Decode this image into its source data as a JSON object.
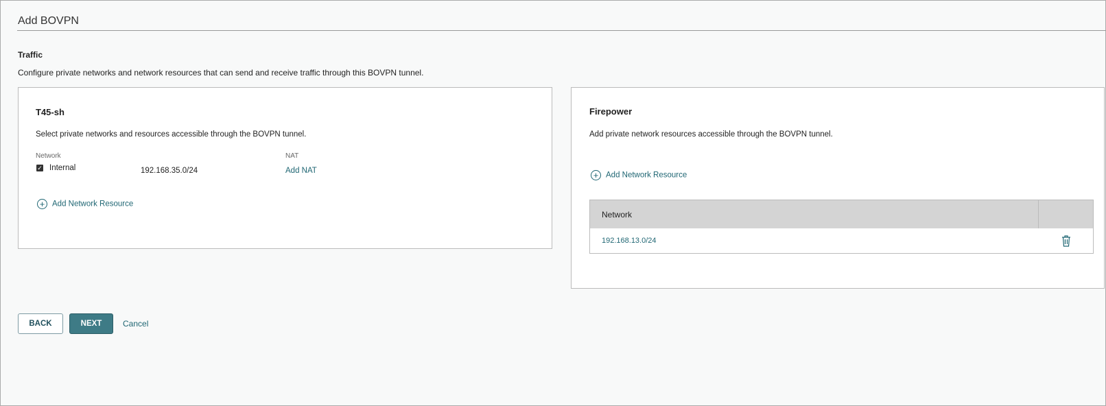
{
  "page": {
    "title": "Add BOVPN",
    "section": "Traffic",
    "description": "Configure private networks and network resources that can send and receive traffic through this BOVPN tunnel."
  },
  "left": {
    "title": "T45-sh",
    "description": "Select private networks and resources accessible through the BOVPN tunnel.",
    "col_network": "Network",
    "col_nat": "NAT",
    "rows": [
      {
        "name": "Internal",
        "checked": true,
        "subnet": "192.168.35.0/24",
        "nat_link": "Add NAT"
      }
    ],
    "add_resource": "Add Network Resource"
  },
  "right": {
    "title": "Firepower",
    "description": "Add private network resources accessible through the BOVPN tunnel.",
    "add_resource": "Add Network Resource",
    "table_header": "Network",
    "rows": [
      {
        "network": "192.168.13.0/24",
        "action_icon": "trash-icon"
      }
    ]
  },
  "buttons": {
    "back": "BACK",
    "next": "NEXT",
    "cancel": "Cancel"
  },
  "colors": {
    "accent": "#1f6673",
    "primary_button": "#3e7b86"
  }
}
